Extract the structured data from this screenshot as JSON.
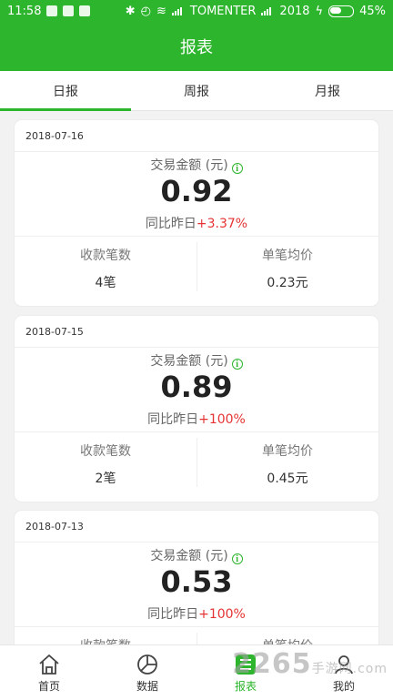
{
  "status_bar": {
    "time": "11:58",
    "carrier": "TOMENTER",
    "signal2_label": "2018",
    "battery": "45%"
  },
  "header": {
    "title": "报表"
  },
  "tabs": [
    {
      "label": "日报",
      "active": true
    },
    {
      "label": "周报",
      "active": false
    },
    {
      "label": "月报",
      "active": false
    }
  ],
  "cards": [
    {
      "date": "2018-07-16",
      "amount_label": "交易金额 (元)",
      "amount": "0.92",
      "compare_label": "同比昨日",
      "compare_pct": "+3.37%",
      "count_label": "收款笔数",
      "count_value": "4笔",
      "avg_label": "单笔均价",
      "avg_value": "0.23元"
    },
    {
      "date": "2018-07-15",
      "amount_label": "交易金额 (元)",
      "amount": "0.89",
      "compare_label": "同比昨日",
      "compare_pct": "+100%",
      "count_label": "收款笔数",
      "count_value": "2笔",
      "avg_label": "单笔均价",
      "avg_value": "0.45元"
    },
    {
      "date": "2018-07-13",
      "amount_label": "交易金额 (元)",
      "amount": "0.53",
      "compare_label": "同比昨日",
      "compare_pct": "+100%",
      "count_label": "收款笔数",
      "count_value": "",
      "avg_label": "单笔均价",
      "avg_value": ""
    }
  ],
  "bottom_nav": [
    {
      "label": "首页",
      "icon": "home-icon"
    },
    {
      "label": "数据",
      "icon": "pie-chart-icon"
    },
    {
      "label": "报表",
      "icon": "report-icon",
      "active": true
    },
    {
      "label": "我的",
      "icon": "user-icon"
    }
  ],
  "watermark": {
    "text": "2265",
    "suffix": "手游网",
    "domain": ".com"
  },
  "colors": {
    "brand": "#2db52d",
    "positive": "#e53333"
  }
}
